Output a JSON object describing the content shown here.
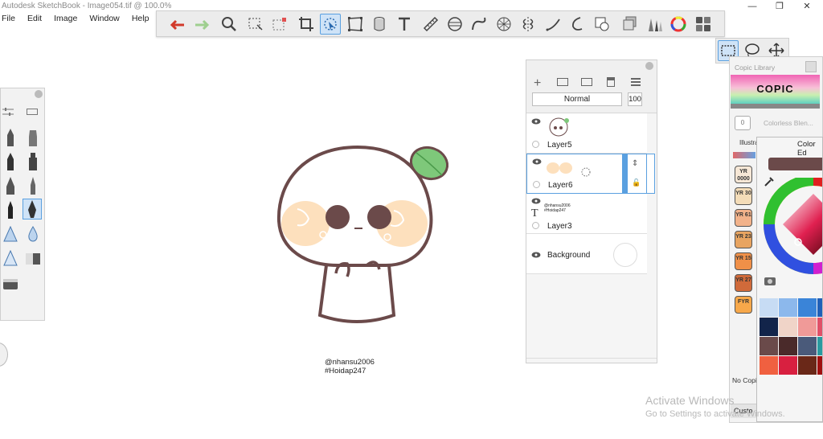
{
  "window": {
    "title": "Autodesk SketchBook - Image054.tif @ 100.0%",
    "buttons": {
      "minimize": "—",
      "maximize": "❐",
      "close": "✕"
    }
  },
  "menu": [
    "File",
    "Edit",
    "Image",
    "Window",
    "Help"
  ],
  "toolbar": {
    "tools": [
      "undo-icon",
      "redo-icon",
      "zoom-icon",
      "select-icon",
      "magic-select-icon",
      "crop-icon",
      "transform-icon",
      "distort-icon",
      "cylinder-icon",
      "text-icon",
      "ruler-icon",
      "ellipse-guide-icon",
      "french-curve-icon",
      "perspective-icon",
      "symmetry-icon",
      "stroke-icon",
      "shape-icon",
      "copy-paste-icon",
      "layers-icon",
      "brushes-icon",
      "color-wheel-icon",
      "lagoon-icon"
    ],
    "selected_tool": "transform-icon",
    "subtools": [
      "rect-select-icon",
      "lasso-select-icon",
      "move-icon"
    ]
  },
  "canvas": {
    "credit_line1": "@nhansu2006",
    "credit_line2": "#Hoidap247"
  },
  "layers": {
    "blend_mode": "Normal",
    "opacity": "100",
    "items": [
      {
        "name": "Layer5"
      },
      {
        "name": "Layer6"
      },
      {
        "name": "Layer3",
        "text_preview_1": "@nhansu2006",
        "text_preview_2": "#Hoidap247"
      },
      {
        "name": "Background"
      }
    ]
  },
  "copic": {
    "title": "Copic Library",
    "logo": "COPIC",
    "colorless": "Colorless Blen...",
    "colorless_code": "0",
    "tab": "Illustra",
    "no_copic": "No Copi",
    "custom": "Custo",
    "swatches": [
      {
        "code": "YR 0000",
        "color": "#f6e7d6"
      },
      {
        "code": "YR 30",
        "color": "#f3dcb8"
      },
      {
        "code": "YR 61",
        "color": "#f2b28a"
      },
      {
        "code": "YR 23",
        "color": "#e8a460"
      },
      {
        "code": "YR 15",
        "color": "#f09048"
      },
      {
        "code": "YR 27",
        "color": "#d06a3a"
      },
      {
        "code": "FYR",
        "color": "#f7a84a"
      }
    ]
  },
  "color_editor": {
    "title": "Color Ed",
    "current": "#6b4a4a",
    "palette": [
      "#c7dcf4",
      "#8cb8ec",
      "#3a84d8",
      "#2060b8",
      "#12244a",
      "#f0d4c8",
      "#f09a98",
      "#e05068",
      "#6a4a4a",
      "#4a2a2a",
      "#4a5a7a",
      "#2a9aa0",
      "#f06040",
      "#d82040",
      "#6a2818",
      "#a01010"
    ]
  },
  "watermark": {
    "line1": "Activate Windows",
    "line2": "Go to Settings to activate Windows."
  }
}
